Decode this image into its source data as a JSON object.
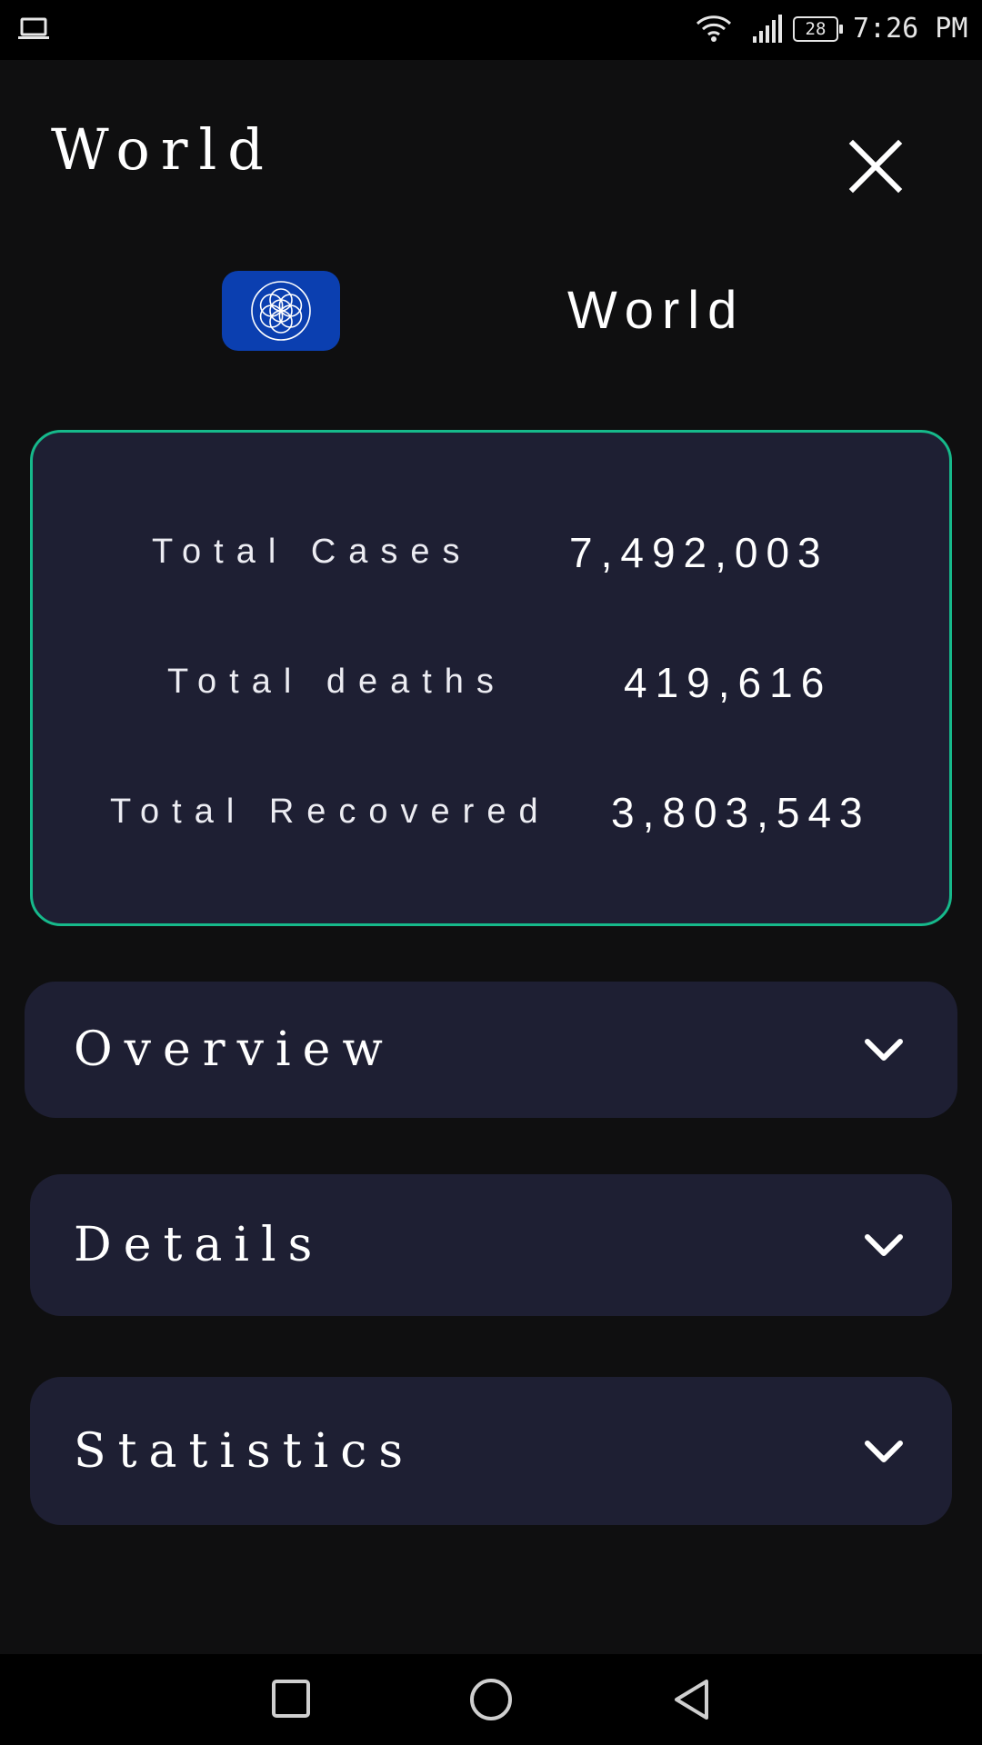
{
  "status_bar": {
    "time": "7:26 PM",
    "battery": "28",
    "icons": [
      "laptop-icon",
      "wifi-icon",
      "signal-icon",
      "battery-icon"
    ]
  },
  "header": {
    "title": "World",
    "close_icon": "close-icon"
  },
  "country": {
    "name": "World",
    "flag_icon": "world-flag-icon"
  },
  "totals": {
    "cases_label": "Total Cases",
    "cases_value": "7,492,003",
    "deaths_label": "Total deaths",
    "deaths_value": "419,616",
    "recovered_label": "Total Recovered",
    "recovered_value": "3,803,543"
  },
  "sections": [
    {
      "label": "Overview"
    },
    {
      "label": "Details"
    },
    {
      "label": "Statistics"
    }
  ],
  "nav": {
    "icons": [
      "recents-square-icon",
      "home-circle-icon",
      "back-triangle-icon"
    ]
  },
  "colors": {
    "background": "#0f0f10",
    "card": "#1e1f33",
    "card_border": "#16b98b",
    "flag_blue": "#0b3fb0"
  }
}
